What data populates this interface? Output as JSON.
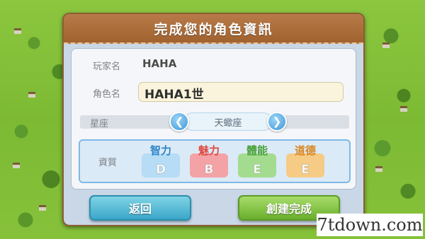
{
  "dialog": {
    "title": "完成您的角色資訊",
    "player_name_label": "玩家名",
    "player_name_value": "HAHA",
    "character_name_label": "角色名",
    "character_name_value": "HAHA1世",
    "zodiac_label": "星座",
    "zodiac_value": "天蠍座",
    "traits_label": "資質",
    "traits": [
      {
        "name": "智力",
        "grade": "D",
        "name_color": "#2e86c9",
        "tile_color": "#b6dcf6"
      },
      {
        "name": "魅力",
        "grade": "B",
        "name_color": "#e0473f",
        "tile_color": "#f3a3a6"
      },
      {
        "name": "體能",
        "grade": "E",
        "name_color": "#4aa23a",
        "tile_color": "#a4dc8f"
      },
      {
        "name": "道德",
        "grade": "E",
        "name_color": "#d9861e",
        "tile_color": "#f5cb86"
      }
    ],
    "back_button": "返回",
    "create_button": "創建完成"
  },
  "watermark": "7tdown.com",
  "icons": {
    "prev": "chevron-left-icon",
    "next": "chevron-right-icon"
  }
}
